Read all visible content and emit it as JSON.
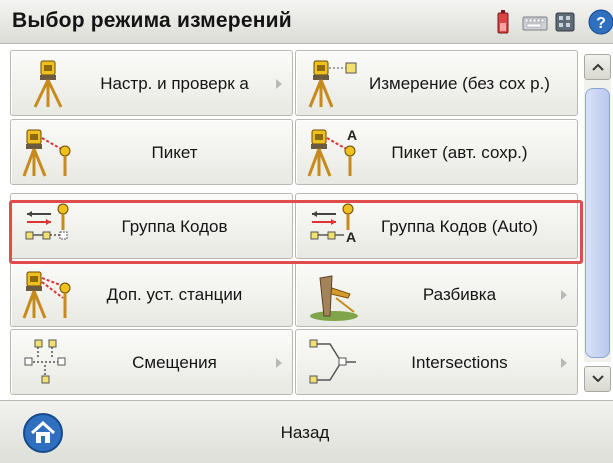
{
  "window": {
    "title": "Выбор режима измерений"
  },
  "status_icons": [
    "battery-icon",
    "keyboard-icon",
    "memory-card-icon",
    "help-icon"
  ],
  "menu": [
    {
      "label": "Настр. и проверк а",
      "icon": "setup-check-icon",
      "has_submenu": true
    },
    {
      "label": "Измерение (без сох р.)",
      "icon": "measure-no-save-icon",
      "has_submenu": false
    },
    {
      "label": "Пикет",
      "icon": "point-icon",
      "has_submenu": false
    },
    {
      "label": "Пикет (авт. сохр.)",
      "icon": "point-auto-save-icon",
      "has_submenu": false
    },
    {
      "label": "Группа Кодов",
      "icon": "code-group-icon",
      "has_submenu": false
    },
    {
      "label": "Группа Кодов (Auto)",
      "icon": "code-group-auto-icon",
      "has_submenu": false
    },
    {
      "label": "Доп. уст. станции",
      "icon": "extra-station-setup-icon",
      "has_submenu": false
    },
    {
      "label": "Разбивка",
      "icon": "stakeout-icon",
      "has_submenu": true
    },
    {
      "label": "Смещения",
      "icon": "offsets-icon",
      "has_submenu": true
    },
    {
      "label": "Intersections",
      "icon": "intersections-icon",
      "has_submenu": true
    }
  ],
  "footer": {
    "back_label": "Назад"
  },
  "colors": {
    "highlight": "#e04b4b",
    "accent_blue": "#2f6fc0"
  }
}
